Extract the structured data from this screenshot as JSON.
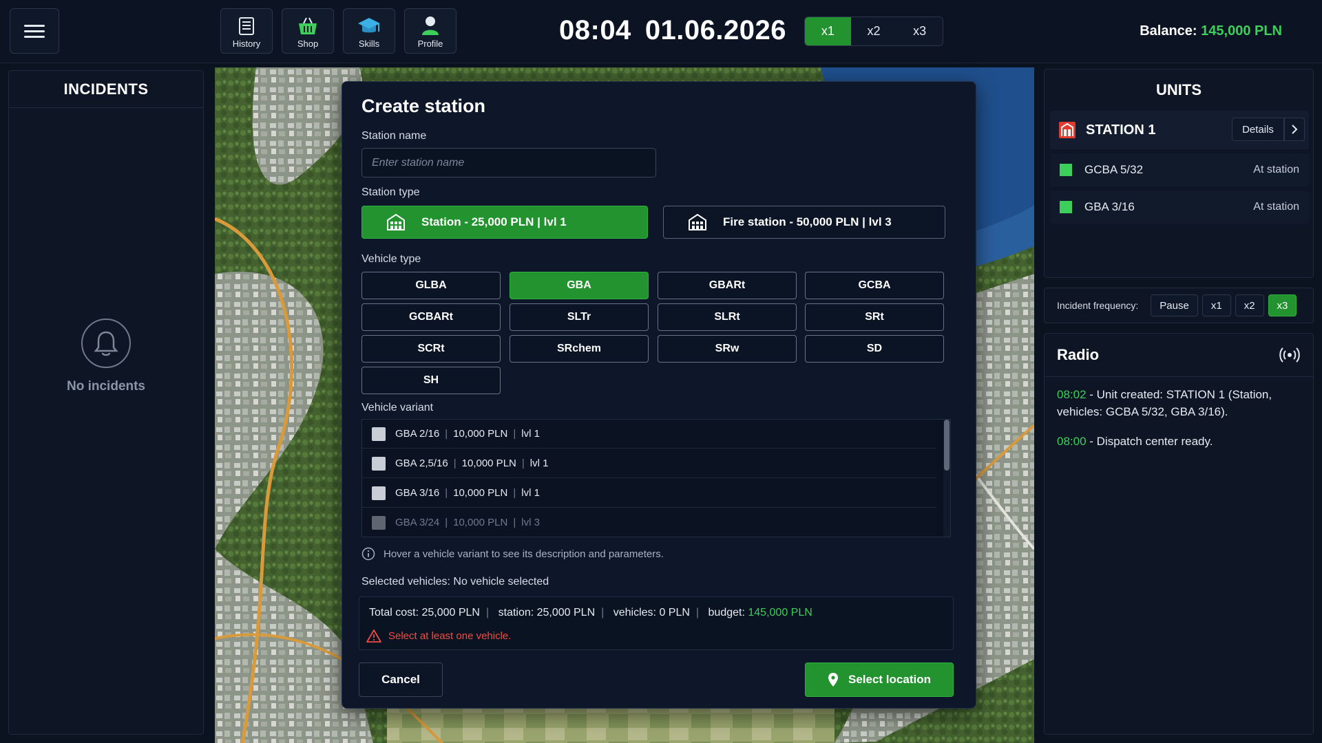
{
  "topbar": {
    "nav": [
      {
        "label": "History",
        "icon": "history-icon"
      },
      {
        "label": "Shop",
        "icon": "basket-icon"
      },
      {
        "label": "Skills",
        "icon": "graduation-cap-icon"
      },
      {
        "label": "Profile",
        "icon": "person-icon"
      }
    ],
    "time": "08:04",
    "date": "01.06.2026",
    "speeds": [
      "x1",
      "x2",
      "x3"
    ],
    "active_speed": "x1",
    "balance_label": "Balance:",
    "balance_value": "145,000 PLN"
  },
  "incidents": {
    "title": "INCIDENTS",
    "empty_text": "No incidents"
  },
  "dialog": {
    "title": "Create station",
    "station_name_label": "Station name",
    "station_name_placeholder": "Enter station name",
    "station_name_value": "",
    "station_type_label": "Station type",
    "station_types": [
      {
        "label": "Station - 25,000 PLN | lvl 1",
        "selected": true
      },
      {
        "label": "Fire station - 50,000 PLN | lvl 3",
        "selected": false
      }
    ],
    "vehicle_type_label": "Vehicle type",
    "vehicle_types": [
      "GLBA",
      "GBA",
      "GBARt",
      "GCBA",
      "GCBARt",
      "SLTr",
      "SLRt",
      "SRt",
      "SCRt",
      "SRchem",
      "SRw",
      "SD",
      "SH"
    ],
    "selected_vehicle_type": "GBA",
    "vehicle_variant_label": "Vehicle variant",
    "variants": [
      {
        "name": "GBA 2/16",
        "price": "10,000 PLN",
        "level": "lvl 1",
        "available": true
      },
      {
        "name": "GBA 2,5/16",
        "price": "10,000 PLN",
        "level": "lvl 1",
        "available": true
      },
      {
        "name": "GBA 3/16",
        "price": "10,000 PLN",
        "level": "lvl 1",
        "available": true
      },
      {
        "name": "GBA 3/24",
        "price": "10,000 PLN",
        "level": "lvl 3",
        "available": false
      }
    ],
    "hint": "Hover a vehicle variant to see its description and parameters.",
    "selected_vehicles": "Selected vehicles: No vehicle selected",
    "cost": {
      "total": "Total cost: 25,000 PLN",
      "station": "station: 25,000 PLN",
      "vehicles": "vehicles: 0 PLN",
      "budget_label": "budget:",
      "budget_value": "145,000 PLN"
    },
    "warning": "Select at least one vehicle.",
    "cancel_label": "Cancel",
    "select_location_label": "Select location"
  },
  "units": {
    "title": "UNITS",
    "station_name": "STATION 1",
    "details_label": "Details",
    "vehicles": [
      {
        "name": "GCBA 5/32",
        "status": "At station"
      },
      {
        "name": "GBA 3/16",
        "status": "At station"
      }
    ]
  },
  "frequency": {
    "label": "Incident frequency:",
    "options": [
      "Pause",
      "x1",
      "x2",
      "x3"
    ],
    "active": "x3"
  },
  "radio": {
    "title": "Radio",
    "messages": [
      {
        "time": "08:02",
        "text": " - Unit created: STATION 1 (Station, vehicles: GCBA 5/32, GBA 3/16)."
      },
      {
        "time": "08:00",
        "text": " - Dispatch center ready."
      }
    ]
  },
  "colors": {
    "accent_green": "#22932f",
    "value_green": "#3ccf5a",
    "warning_red": "#ef4c43",
    "panel_bg": "#0e1626"
  }
}
